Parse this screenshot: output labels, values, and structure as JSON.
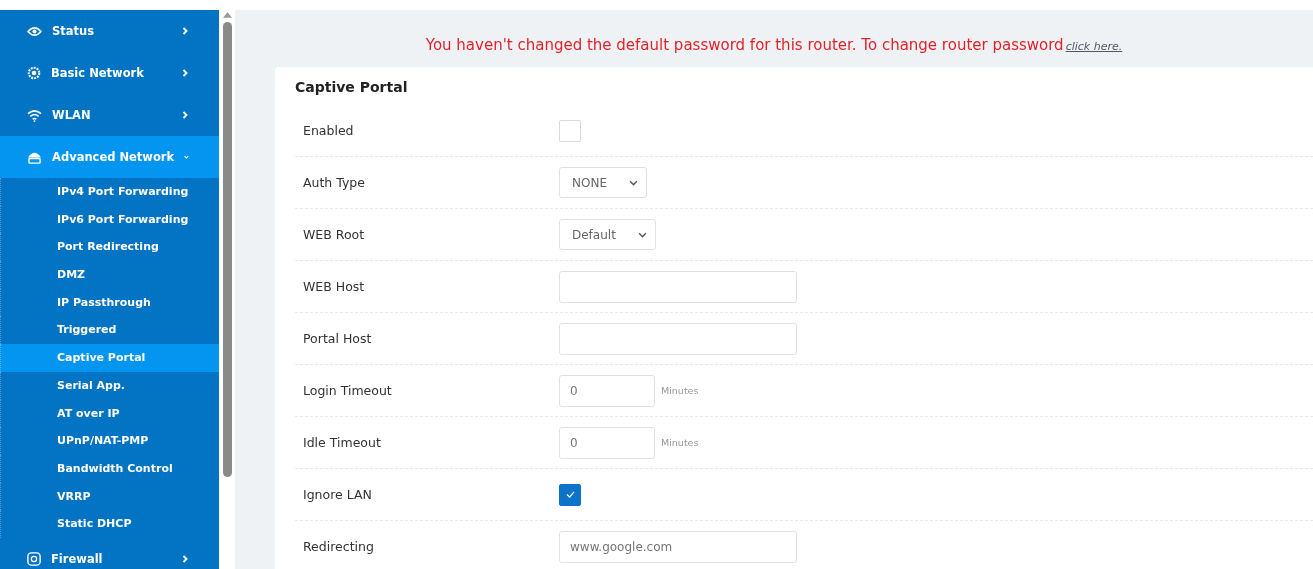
{
  "sidebar": {
    "items": [
      {
        "label": "Status",
        "expanded": false,
        "selected": false
      },
      {
        "label": "Basic Network",
        "expanded": false,
        "selected": false
      },
      {
        "label": "WLAN",
        "expanded": false,
        "selected": false
      },
      {
        "label": "Advanced Network",
        "expanded": true,
        "selected": true,
        "children": [
          {
            "label": "IPv4 Port Forwarding",
            "selected": false
          },
          {
            "label": "IPv6 Port Forwarding",
            "selected": false
          },
          {
            "label": "Port Redirecting",
            "selected": false
          },
          {
            "label": "DMZ",
            "selected": false
          },
          {
            "label": "IP Passthrough",
            "selected": false
          },
          {
            "label": "Triggered",
            "selected": false
          },
          {
            "label": "Captive Portal",
            "selected": true
          },
          {
            "label": "Serial App.",
            "selected": false
          },
          {
            "label": "AT over IP",
            "selected": false
          },
          {
            "label": "UPnP/NAT-PMP",
            "selected": false
          },
          {
            "label": "Bandwidth Control",
            "selected": false
          },
          {
            "label": "VRRP",
            "selected": false
          },
          {
            "label": "Static DHCP",
            "selected": false
          }
        ]
      },
      {
        "label": "Firewall",
        "expanded": false,
        "selected": false
      }
    ]
  },
  "warning": {
    "text": "You haven't changed the default password for this router. To change router password",
    "link": "click here."
  },
  "form": {
    "title": "Captive Portal",
    "rows": [
      {
        "kind": "checkbox",
        "label": "Enabled",
        "checked": false
      },
      {
        "kind": "select",
        "label": "Auth Type",
        "value": "NONE"
      },
      {
        "kind": "select",
        "label": "WEB Root",
        "value": "Default"
      },
      {
        "kind": "text",
        "label": "WEB Host"
      },
      {
        "kind": "text",
        "label": "Portal Host"
      },
      {
        "kind": "number",
        "label": "Login Timeout",
        "value": "0",
        "unit": "Minutes"
      },
      {
        "kind": "number",
        "label": "Idle Timeout",
        "value": "0",
        "unit": "Minutes"
      },
      {
        "kind": "checkbox",
        "label": "Ignore LAN",
        "checked": true
      },
      {
        "kind": "text",
        "label": "Redirecting",
        "value": "www.google.com"
      }
    ]
  }
}
